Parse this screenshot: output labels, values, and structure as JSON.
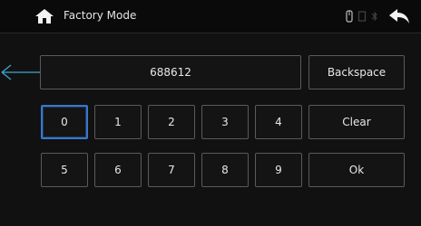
{
  "header": {
    "title": "Factory Mode",
    "home_icon": "home-icon",
    "back_icon": "back-arrow-icon",
    "status_icons": [
      "usb-icon",
      "storage-icon",
      "bluetooth-icon"
    ]
  },
  "display": {
    "value": "688612"
  },
  "keypad": {
    "row1": [
      "0",
      "1",
      "2",
      "3",
      "4"
    ],
    "row2": [
      "5",
      "6",
      "7",
      "8",
      "9"
    ],
    "selected": "0"
  },
  "actions": {
    "backspace": "Backspace",
    "clear": "Clear",
    "ok": "Ok"
  },
  "colors": {
    "accent": "#3a78c9",
    "annotation": "#3fa9d6",
    "background": "#111111"
  }
}
